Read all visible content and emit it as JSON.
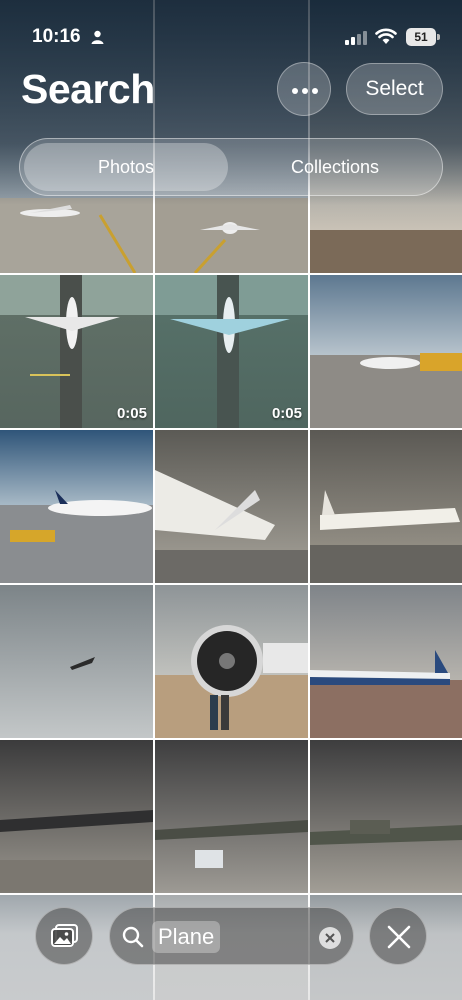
{
  "status_bar": {
    "time": "10:16",
    "battery": "51",
    "icons": [
      "person-icon",
      "signal-icon",
      "wifi-icon",
      "battery-icon"
    ]
  },
  "header": {
    "title": "Search",
    "more_icon": "ellipsis-icon",
    "select_label": "Select"
  },
  "segmented_control": {
    "tabs": [
      {
        "label": "Photos",
        "selected": true
      },
      {
        "label": "Collections",
        "selected": false
      }
    ]
  },
  "grid": {
    "photos": [
      {
        "subject": "plane on taxiway",
        "duration": ""
      },
      {
        "subject": "plane taxiing",
        "duration": ""
      },
      {
        "subject": "airport skyline",
        "duration": ""
      },
      {
        "subject": "plane on runway",
        "duration": "0:05"
      },
      {
        "subject": "plane on runway",
        "duration": "0:05"
      },
      {
        "subject": "plane at gate",
        "duration": ""
      },
      {
        "subject": "Lufthansa plane at gate",
        "duration": ""
      },
      {
        "subject": "space shuttle in hangar",
        "duration": ""
      },
      {
        "subject": "space shuttle in hangar",
        "duration": ""
      },
      {
        "subject": "plane in sky",
        "duration": ""
      },
      {
        "subject": "jet engine with people",
        "duration": ""
      },
      {
        "subject": "presidential plane",
        "duration": ""
      },
      {
        "subject": "aircraft museum hangar",
        "duration": ""
      },
      {
        "subject": "aircraft museum hangar",
        "duration": ""
      },
      {
        "subject": "Spitfire in hangar",
        "duration": ""
      }
    ]
  },
  "bottom_bar": {
    "library_icon": "photo-library-icon",
    "search_icon": "magnifier-icon",
    "search_query": "Plane",
    "clear_icon": "clear-x-icon",
    "close_icon": "close-icon"
  },
  "colors": {
    "header_tint": "#1e3246",
    "text": "#ffffff"
  }
}
